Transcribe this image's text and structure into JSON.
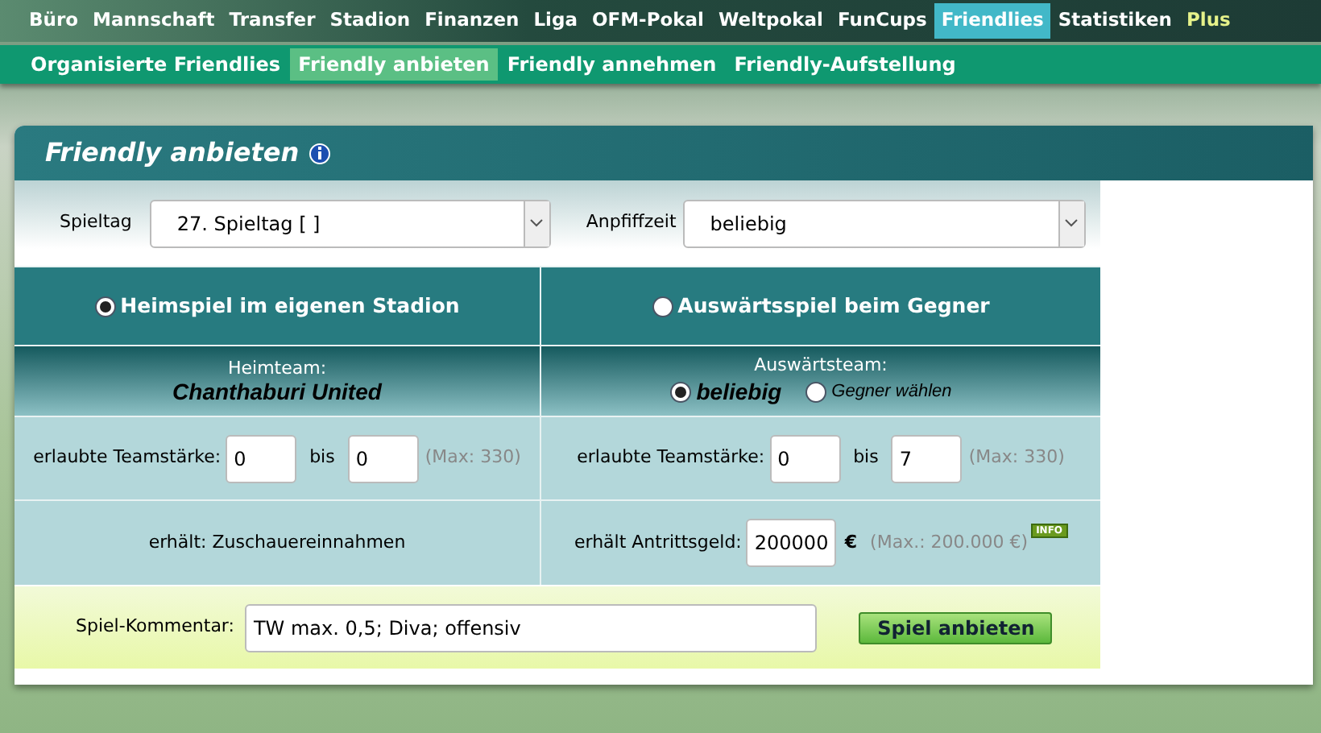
{
  "main_nav": [
    {
      "label": "Büro",
      "selected": false,
      "kind": "normal"
    },
    {
      "label": "Mannschaft",
      "selected": false,
      "kind": "normal"
    },
    {
      "label": "Transfer",
      "selected": false,
      "kind": "normal"
    },
    {
      "label": "Stadion",
      "selected": false,
      "kind": "normal"
    },
    {
      "label": "Finanzen",
      "selected": false,
      "kind": "normal"
    },
    {
      "label": "Liga",
      "selected": false,
      "kind": "normal"
    },
    {
      "label": "OFM-Pokal",
      "selected": false,
      "kind": "normal"
    },
    {
      "label": "Weltpokal",
      "selected": false,
      "kind": "normal"
    },
    {
      "label": "FunCups",
      "selected": false,
      "kind": "normal"
    },
    {
      "label": "Friendlies",
      "selected": true,
      "kind": "normal"
    },
    {
      "label": "Statistiken",
      "selected": false,
      "kind": "normal"
    },
    {
      "label": "Plus",
      "selected": false,
      "kind": "plus"
    }
  ],
  "sub_nav": [
    {
      "label": "Organisierte Friendlies",
      "selected": false
    },
    {
      "label": "Friendly anbieten",
      "selected": true
    },
    {
      "label": "Friendly annehmen",
      "selected": false
    },
    {
      "label": "Friendly-Aufstellung",
      "selected": false
    }
  ],
  "panel": {
    "title": "Friendly anbieten",
    "spieltag": {
      "label": "Spieltag",
      "value": "27. Spieltag [ ]"
    },
    "anpfiffzeit": {
      "label": "Anpfiffzeit",
      "value": "beliebig"
    },
    "home": {
      "option": "Heimspiel im eigenen Stadion",
      "selected": true,
      "team_label": "Heimteam:",
      "team_name": "Chanthaburi United",
      "strength_label": "erlaubte Teamstärke:",
      "strength_min": "0",
      "bis": "bis",
      "strength_max": "0",
      "max_note": "(Max: 330)",
      "receives": "erhält: Zuschauereinnahmen"
    },
    "away": {
      "option": "Auswärtsspiel beim Gegner",
      "selected": false,
      "team_label": "Auswärtsteam:",
      "team_choices": [
        {
          "label": "beliebig",
          "selected": true
        },
        {
          "label": "Gegner wählen",
          "selected": false
        }
      ],
      "strength_label": "erlaubte Teamstärke:",
      "strength_min": "0",
      "bis": "bis",
      "strength_max": "7",
      "max_note": "(Max: 330)",
      "fee_label": "erhält Antrittsgeld:",
      "fee_value": "200000",
      "currency": "€",
      "fee_max": "(Max.: 200.000 €)",
      "info_badge": "INFO"
    },
    "comment": {
      "label": "Spiel-Kommentar:",
      "value": "TW max. 0,5; Diva; offensiv"
    },
    "submit": "Spiel anbieten"
  }
}
